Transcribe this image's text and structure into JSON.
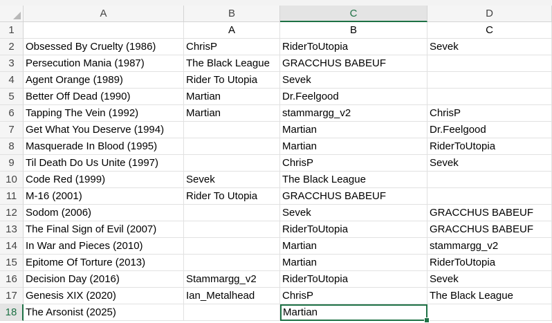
{
  "columns": [
    "A",
    "B",
    "C",
    "D"
  ],
  "selected_column": "C",
  "selected_row": 18,
  "accent_color": "#1e7145",
  "rows": [
    {
      "num": "1",
      "cells": [
        "",
        "A",
        "B",
        "C"
      ]
    },
    {
      "num": "2",
      "cells": [
        "Obsessed By Cruelty (1986)",
        "ChrisP",
        "RiderToUtopia",
        "Sevek"
      ]
    },
    {
      "num": "3",
      "cells": [
        "Persecution Mania (1987)",
        "The Black League",
        "GRACCHUS BABEUF",
        ""
      ]
    },
    {
      "num": "4",
      "cells": [
        "Agent Orange (1989)",
        "Rider To Utopia",
        "Sevek",
        ""
      ]
    },
    {
      "num": "5",
      "cells": [
        "Better Off Dead (1990)",
        "Martian",
        "Dr.Feelgood",
        ""
      ]
    },
    {
      "num": "6",
      "cells": [
        "Tapping The Vein (1992)",
        "Martian",
        "stammargg_v2",
        "ChrisP"
      ]
    },
    {
      "num": "7",
      "cells": [
        "Get What You Deserve (1994)",
        "",
        "Martian",
        "Dr.Feelgood"
      ]
    },
    {
      "num": "8",
      "cells": [
        "Masquerade In Blood (1995)",
        "",
        "Martian",
        "RiderToUtopia"
      ]
    },
    {
      "num": "9",
      "cells": [
        "Til Death Do Us Unite (1997)",
        "",
        "ChrisP",
        "Sevek"
      ]
    },
    {
      "num": "10",
      "cells": [
        "Code Red (1999)",
        "Sevek",
        "The Black League",
        ""
      ]
    },
    {
      "num": "11",
      "cells": [
        "M-16 (2001)",
        "Rider To Utopia",
        "GRACCHUS BABEUF",
        ""
      ]
    },
    {
      "num": "12",
      "cells": [
        "Sodom (2006)",
        "",
        "Sevek",
        "GRACCHUS BABEUF"
      ]
    },
    {
      "num": "13",
      "cells": [
        "The Final Sign of Evil (2007)",
        "",
        "RiderToUtopia",
        "GRACCHUS BABEUF"
      ]
    },
    {
      "num": "14",
      "cells": [
        "In War and Pieces (2010)",
        "",
        "Martian",
        "stammargg_v2"
      ]
    },
    {
      "num": "15",
      "cells": [
        "Epitome Of Torture (2013)",
        "",
        "Martian",
        "RiderToUtopia"
      ]
    },
    {
      "num": "16",
      "cells": [
        "Decision Day (2016)",
        "Stammargg_v2",
        "RiderToUtopia",
        "Sevek"
      ]
    },
    {
      "num": "17",
      "cells": [
        "Genesis XIX (2020)",
        "Ian_Metalhead",
        "ChrisP",
        "The Black League"
      ]
    },
    {
      "num": "18",
      "cells": [
        "The Arsonist (2025)",
        "",
        "Martian",
        ""
      ]
    }
  ]
}
